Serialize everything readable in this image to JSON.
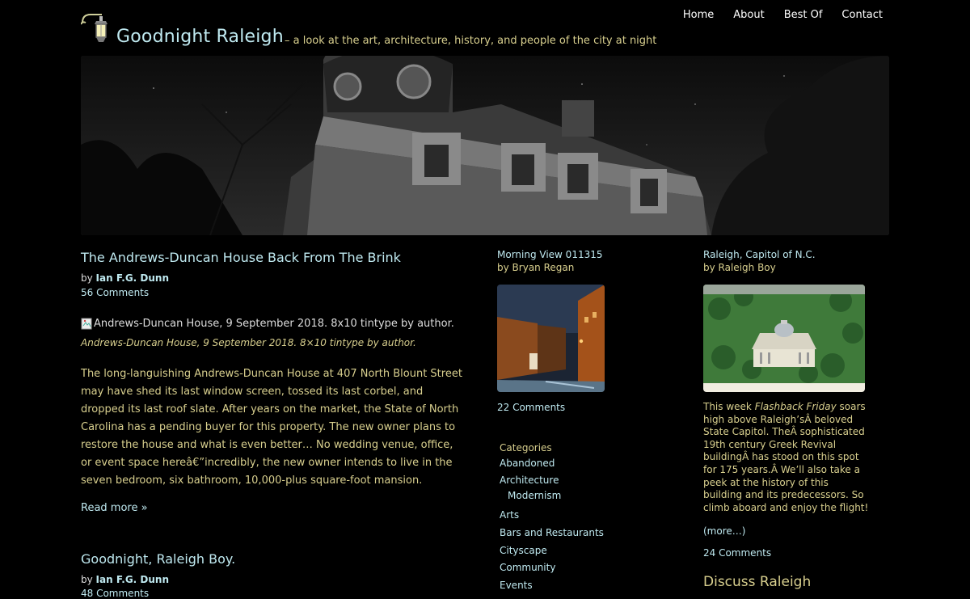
{
  "header": {
    "site_title": "Goodnight Raleigh",
    "tagline": "– a look at the art, architecture, history, and people of the city at night",
    "nav": [
      "Home",
      "About",
      "Best Of",
      "Contact"
    ]
  },
  "posts": [
    {
      "title": "The Andrews-Duncan House Back From The Brink",
      "by_label": "by",
      "author": "Ian F.G. Dunn",
      "comments": "56 Comments",
      "image_alt": "Andrews-Duncan House, 9 September 2018. 8x10 tintype by author.",
      "caption": "Andrews-Duncan House, 9 September 2018. 8×10 tintype by author.",
      "excerpt": "The long-languishing Andrews-Duncan House at 407 North Blount Street may have shed its last window screen, tossed its last corbel, and dropped its last roof slate. After years on the market, the State of North Carolina has a pending buyer for this property. The new owner plans to restore the house and what is even better… No wedding venue, office, or event space hereâ€”incredibly, the new owner intends to live in the seven bedroom, six bathroom, 10,000-plus square-foot mansion.",
      "read_more": "Read more »"
    },
    {
      "title": "Goodnight, Raleigh Boy.",
      "by_label": "by",
      "author": "Ian F.G. Dunn",
      "comments": "48 Comments"
    }
  ],
  "middle": {
    "feature": {
      "title": "Morning View 011315",
      "by_label": "by",
      "author": "Bryan Regan",
      "comments": "22 Comments"
    },
    "categories_heading": "Categories",
    "categories": [
      {
        "label": "Abandoned",
        "sub": false
      },
      {
        "label": "Architecture",
        "sub": false
      },
      {
        "label": "Modernism",
        "sub": true
      },
      {
        "label": "Arts",
        "sub": false
      },
      {
        "label": "Bars and Restaurants",
        "sub": false
      },
      {
        "label": "Cityscape",
        "sub": false
      },
      {
        "label": "Community",
        "sub": false
      },
      {
        "label": "Events",
        "sub": false
      }
    ]
  },
  "right": {
    "feature": {
      "title": "Raleigh, Capitol of N.C.",
      "by_label": "by",
      "author": "Raleigh Boy",
      "excerpt_pre": "This week ",
      "excerpt_em": "Flashback Friday",
      "excerpt_post": " soars high above Raleigh’sÂ beloved State Capitol. TheÂ sophisticated 19th century Greek Revival buildingÂ has stood on this spot for 175 years.Â We’ll also take a peek at the history of this building and its predecessors. So climb aboard and enjoy the flight!",
      "more": "(more…)",
      "comments": "24 Comments"
    },
    "discuss_heading": "Discuss Raleigh"
  },
  "colors": {
    "background": "#000000",
    "link": "#bfe9f0",
    "text_gold": "#d8cf8e",
    "text": "#dddddd"
  }
}
